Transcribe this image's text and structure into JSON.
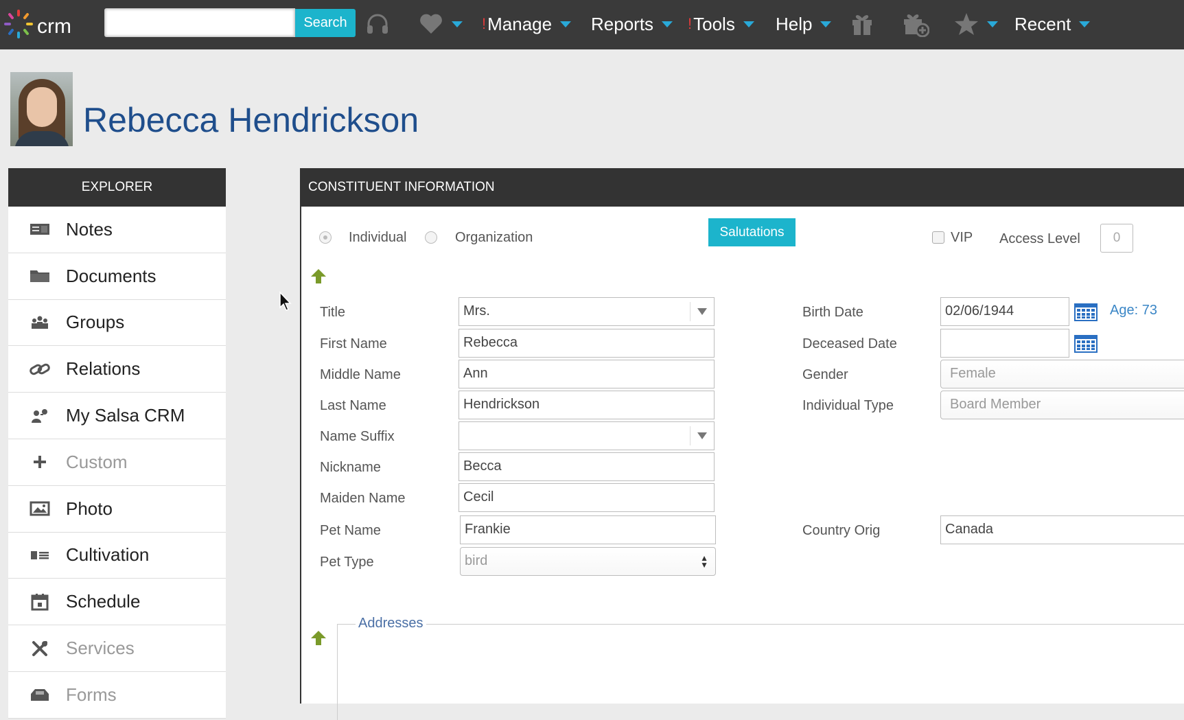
{
  "topbar": {
    "logo_text": "crm",
    "search_value": "",
    "search_button": "Search",
    "menu": {
      "manage": "Manage",
      "reports": "Reports",
      "tools": "Tools",
      "help": "Help",
      "recent": "Recent"
    },
    "alert_mark": "!",
    "accent_color": "#1cb4cc"
  },
  "profile": {
    "name": "Rebecca Hendrickson"
  },
  "explorer": {
    "title": "EXPLORER",
    "items": [
      {
        "label": "Notes",
        "icon": "notes-icon",
        "enabled": true
      },
      {
        "label": "Documents",
        "icon": "folder-icon",
        "enabled": true
      },
      {
        "label": "Groups",
        "icon": "groups-icon",
        "enabled": true
      },
      {
        "label": "Relations",
        "icon": "link-icon",
        "enabled": true
      },
      {
        "label": "My Salsa CRM",
        "icon": "user-key-icon",
        "enabled": true
      },
      {
        "label": "Custom",
        "icon": "plus-icon",
        "enabled": false
      },
      {
        "label": "Photo",
        "icon": "photo-icon",
        "enabled": true
      },
      {
        "label": "Cultivation",
        "icon": "cultivation-icon",
        "enabled": true
      },
      {
        "label": "Schedule",
        "icon": "calendar-icon",
        "enabled": true
      },
      {
        "label": "Services",
        "icon": "tools-icon",
        "enabled": false
      },
      {
        "label": "Forms",
        "icon": "forms-icon",
        "enabled": false
      }
    ]
  },
  "constituent": {
    "title": "CONSTITUENT INFORMATION",
    "type_individual": "Individual",
    "type_organization": "Organization",
    "selected_type": "Individual",
    "salutations_button": "Salutations",
    "vip_label": "VIP",
    "vip_checked": false,
    "access_level_label": "Access Level",
    "access_level_value": "0",
    "left_fields": {
      "title": {
        "label": "Title",
        "value": "Mrs."
      },
      "first_name": {
        "label": "First Name",
        "value": "Rebecca"
      },
      "middle_name": {
        "label": "Middle Name",
        "value": "Ann"
      },
      "last_name": {
        "label": "Last Name",
        "value": "Hendrickson"
      },
      "name_suffix": {
        "label": "Name Suffix",
        "value": ""
      },
      "nickname": {
        "label": "Nickname",
        "value": "Becca"
      },
      "maiden_name": {
        "label": "Maiden Name",
        "value": "Cecil"
      },
      "pet_name": {
        "label": "Pet Name",
        "value": "Frankie"
      },
      "pet_type": {
        "label": "Pet Type",
        "value": "bird"
      }
    },
    "right_fields": {
      "birth_date": {
        "label": "Birth Date",
        "value": "02/06/1944"
      },
      "age": "Age: 73",
      "deceased_date": {
        "label": "Deceased Date",
        "value": ""
      },
      "gender": {
        "label": "Gender",
        "value": "Female"
      },
      "individual_type": {
        "label": "Individual Type",
        "value": "Board Member"
      },
      "country_orig": {
        "label": "Country Orig",
        "value": "Canada"
      }
    },
    "addresses_legend": "Addresses"
  }
}
